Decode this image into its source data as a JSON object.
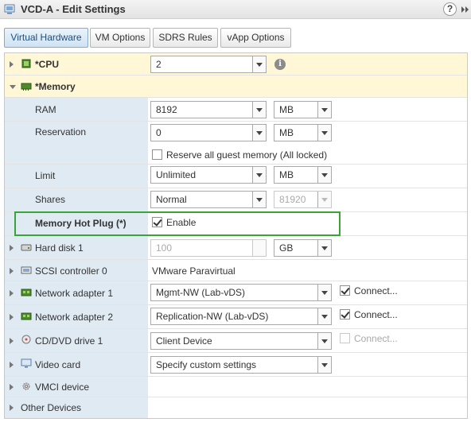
{
  "window": {
    "title": "VCD-A - Edit Settings",
    "help_label": "?"
  },
  "tabs": [
    {
      "label": "Virtual Hardware",
      "active": true
    },
    {
      "label": "VM Options",
      "active": false
    },
    {
      "label": "SDRS Rules",
      "active": false
    },
    {
      "label": "vApp Options",
      "active": false
    }
  ],
  "cpu": {
    "label": "*CPU",
    "value": "2",
    "info_icon": "i"
  },
  "memory": {
    "label": "*Memory",
    "ram": {
      "label": "RAM",
      "value": "8192",
      "unit": "MB"
    },
    "reservation": {
      "label": "Reservation",
      "value": "0",
      "unit": "MB",
      "reserve_all_label": "Reserve all guest memory (All locked)",
      "reserve_all_checked": false
    },
    "limit": {
      "label": "Limit",
      "value": "Unlimited",
      "unit": "MB"
    },
    "shares": {
      "label": "Shares",
      "value": "Normal",
      "count": "81920"
    },
    "hot_plug": {
      "label": "Memory Hot Plug (*)",
      "enable_label": "Enable",
      "checked": true
    }
  },
  "hard_disk": {
    "label": "Hard disk 1",
    "value": "100",
    "unit": "GB"
  },
  "scsi": {
    "label": "SCSI controller 0",
    "value": "VMware Paravirtual"
  },
  "net1": {
    "label": "Network adapter 1",
    "value": "Mgmt-NW (Lab-vDS)",
    "connect_label": "Connect...",
    "connected": true
  },
  "net2": {
    "label": "Network adapter 2",
    "value": "Replication-NW (Lab-vDS)",
    "connect_label": "Connect...",
    "connected": true
  },
  "cdrom": {
    "label": "CD/DVD drive 1",
    "value": "Client Device",
    "connect_label": "Connect...",
    "connected": false
  },
  "video": {
    "label": "Video card",
    "value": "Specify custom settings"
  },
  "vmci": {
    "label": "VMCI device"
  },
  "other": {
    "label": "Other Devices"
  },
  "colors": {
    "highlight_border": "#3aa43a",
    "label_column": "#dfeaf2",
    "active_tab": "#cfe2f3"
  }
}
